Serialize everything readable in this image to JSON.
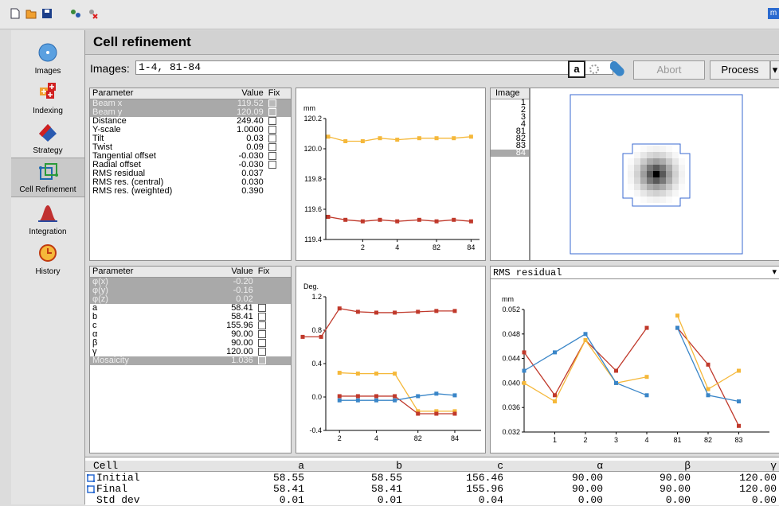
{
  "toolbar": {
    "icons": [
      "new-file-icon",
      "open-folder-icon",
      "save-icon",
      "molecule-tool-icon",
      "delete-tool-icon"
    ],
    "right_badge": "m"
  },
  "sidebar": {
    "items": [
      {
        "label": "Images",
        "icon": "images-icon"
      },
      {
        "label": "Indexing",
        "icon": "indexing-icon"
      },
      {
        "label": "Strategy",
        "icon": "strategy-icon"
      },
      {
        "label": "Cell Refinement",
        "icon": "cell-refinement-icon"
      },
      {
        "label": "Integration",
        "icon": "integration-icon"
      },
      {
        "label": "History",
        "icon": "history-icon"
      }
    ],
    "selected": "Cell Refinement"
  },
  "header": {
    "title": "Cell refinement"
  },
  "images": {
    "label": "Images:",
    "value": "1-4, 81-84"
  },
  "actions": {
    "a_label": "a",
    "abort": "Abort",
    "process": "Process"
  },
  "param_table_1": {
    "headers": [
      "Parameter",
      "Value",
      "Fix"
    ],
    "rows": [
      {
        "name": "Beam x",
        "value": "119.52",
        "grey": true
      },
      {
        "name": "Beam y",
        "value": "120.09",
        "grey": true
      },
      {
        "name": "Distance",
        "value": "249.40",
        "grey": false,
        "fix": true
      },
      {
        "name": "Y-scale",
        "value": "1.0000",
        "grey": false,
        "fix": true
      },
      {
        "name": "Tilt",
        "value": "0.03",
        "grey": false,
        "fix": true
      },
      {
        "name": "Twist",
        "value": "0.09",
        "grey": false,
        "fix": true
      },
      {
        "name": "Tangential offset",
        "value": "-0.030",
        "grey": false,
        "fix": true
      },
      {
        "name": "Radial offset",
        "value": "-0.030",
        "grey": false,
        "fix": true
      },
      {
        "name": "RMS residual",
        "value": "0.037",
        "grey": false,
        "fix": false
      },
      {
        "name": "RMS res. (central)",
        "value": "0.030",
        "grey": false,
        "fix": false
      },
      {
        "name": "RMS res. (weighted)",
        "value": "0.390",
        "grey": false,
        "fix": false
      }
    ]
  },
  "param_table_2": {
    "headers": [
      "Parameter",
      "Value",
      "Fix"
    ],
    "rows": [
      {
        "name": "φ(x)",
        "value": "-0.20",
        "grey": true,
        "fix": false
      },
      {
        "name": "φ(y)",
        "value": "-0.16",
        "grey": true,
        "fix": false
      },
      {
        "name": "φ(z)",
        "value": "0.02",
        "grey": true,
        "fix": false
      },
      {
        "name": "a",
        "value": "58.41",
        "grey": false,
        "fix": true
      },
      {
        "name": "b",
        "value": "58.41",
        "grey": false,
        "fix": true
      },
      {
        "name": "c",
        "value": "155.96",
        "grey": false,
        "fix": true
      },
      {
        "name": "α",
        "value": "90.00",
        "grey": false,
        "fix": true
      },
      {
        "name": "β",
        "value": "90.00",
        "grey": false,
        "fix": true
      },
      {
        "name": "γ",
        "value": "120.00",
        "grey": false,
        "fix": true
      },
      {
        "name": "Mosaicity",
        "value": "1.036",
        "grey": true,
        "fix": true
      }
    ]
  },
  "image_list": {
    "header": "Image",
    "items": [
      "1",
      "2",
      "3",
      "4",
      "81",
      "82",
      "83",
      "84"
    ],
    "selected": "84"
  },
  "rms_dropdown": {
    "value": "RMS residual"
  },
  "chart_data": [
    {
      "type": "scatter",
      "ylabel": "mm",
      "x": [
        "1",
        "2",
        "3",
        "4",
        "81",
        "82",
        "83",
        "84"
      ],
      "xticks": [
        "2",
        "4",
        "82",
        "84"
      ],
      "ylim": [
        119.4,
        120.2
      ],
      "yticks": [
        "120.2",
        "120.0",
        "119.8",
        "119.6",
        "119.4"
      ],
      "series": [
        {
          "color": "#f5b83a",
          "values": [
            120.08,
            120.05,
            120.05,
            120.07,
            120.06,
            120.07,
            120.07,
            120.07,
            120.08
          ]
        },
        {
          "color": "#c0392b",
          "values": [
            119.55,
            119.53,
            119.52,
            119.53,
            119.52,
            119.53,
            119.52,
            119.53,
            119.52
          ]
        }
      ]
    },
    {
      "type": "scatter",
      "ylabel": "Deg.",
      "x": [
        "1",
        "2",
        "3",
        "4",
        "81",
        "82",
        "83",
        "84"
      ],
      "xticks": [
        "2",
        "4",
        "82",
        "84"
      ],
      "ylim": [
        -0.4,
        1.2
      ],
      "yticks": [
        "1.2",
        "0.8",
        "0.4",
        "0.0",
        "-0.4"
      ],
      "series": [
        {
          "color": "#c0392b",
          "values": [
            0.72,
            0.72,
            1.06,
            1.02,
            1.01,
            1.01,
            1.02,
            1.03,
            1.03
          ]
        },
        {
          "color": "#f5b83a",
          "values": [
            null,
            null,
            0.29,
            0.28,
            0.28,
            0.28,
            -0.17,
            -0.17,
            -0.17
          ]
        },
        {
          "color": "#c0392b",
          "values": [
            null,
            null,
            0.01,
            0.01,
            0.01,
            0.01,
            -0.2,
            -0.2,
            -0.2
          ]
        },
        {
          "color": "#3a86c8",
          "values": [
            null,
            null,
            -0.04,
            -0.04,
            -0.04,
            -0.04,
            0.01,
            0.04,
            0.02
          ]
        }
      ]
    },
    {
      "type": "line",
      "ylabel": "mm",
      "x": [
        "1",
        "2",
        "3",
        "4",
        "81",
        "82",
        "83"
      ],
      "xticks": [
        "1",
        "2",
        "3",
        "4",
        "81",
        "82",
        "83"
      ],
      "ylim": [
        0.032,
        0.052
      ],
      "yticks": [
        "0.052",
        "0.048",
        "0.044",
        "0.040",
        "0.036",
        "0.032"
      ],
      "series": [
        {
          "color": "#c0392b",
          "values": [
            0.045,
            0.038,
            0.047,
            0.042,
            0.049,
            0.049,
            0.043,
            0.033
          ]
        },
        {
          "color": "#f5b83a",
          "values": [
            0.04,
            0.037,
            0.047,
            0.04,
            0.041,
            0.051,
            0.039,
            0.042
          ]
        },
        {
          "color": "#3a86c8",
          "values": [
            0.042,
            0.045,
            0.048,
            0.04,
            0.038,
            0.049,
            0.038,
            0.037
          ]
        }
      ]
    }
  ],
  "cell_table": {
    "headers": [
      "Cell",
      "a",
      "b",
      "c",
      "α",
      "β",
      "γ"
    ],
    "rows": [
      {
        "label": "Initial",
        "values": [
          "58.55",
          "58.55",
          "156.46",
          "90.00",
          "90.00",
          "120.00"
        ]
      },
      {
        "label": "Final",
        "values": [
          "58.41",
          "58.41",
          "155.96",
          "90.00",
          "90.00",
          "120.00"
        ]
      },
      {
        "label": "Std dev",
        "values": [
          "0.01",
          "0.01",
          "0.04",
          "0.00",
          "0.00",
          "0.00"
        ]
      }
    ]
  }
}
